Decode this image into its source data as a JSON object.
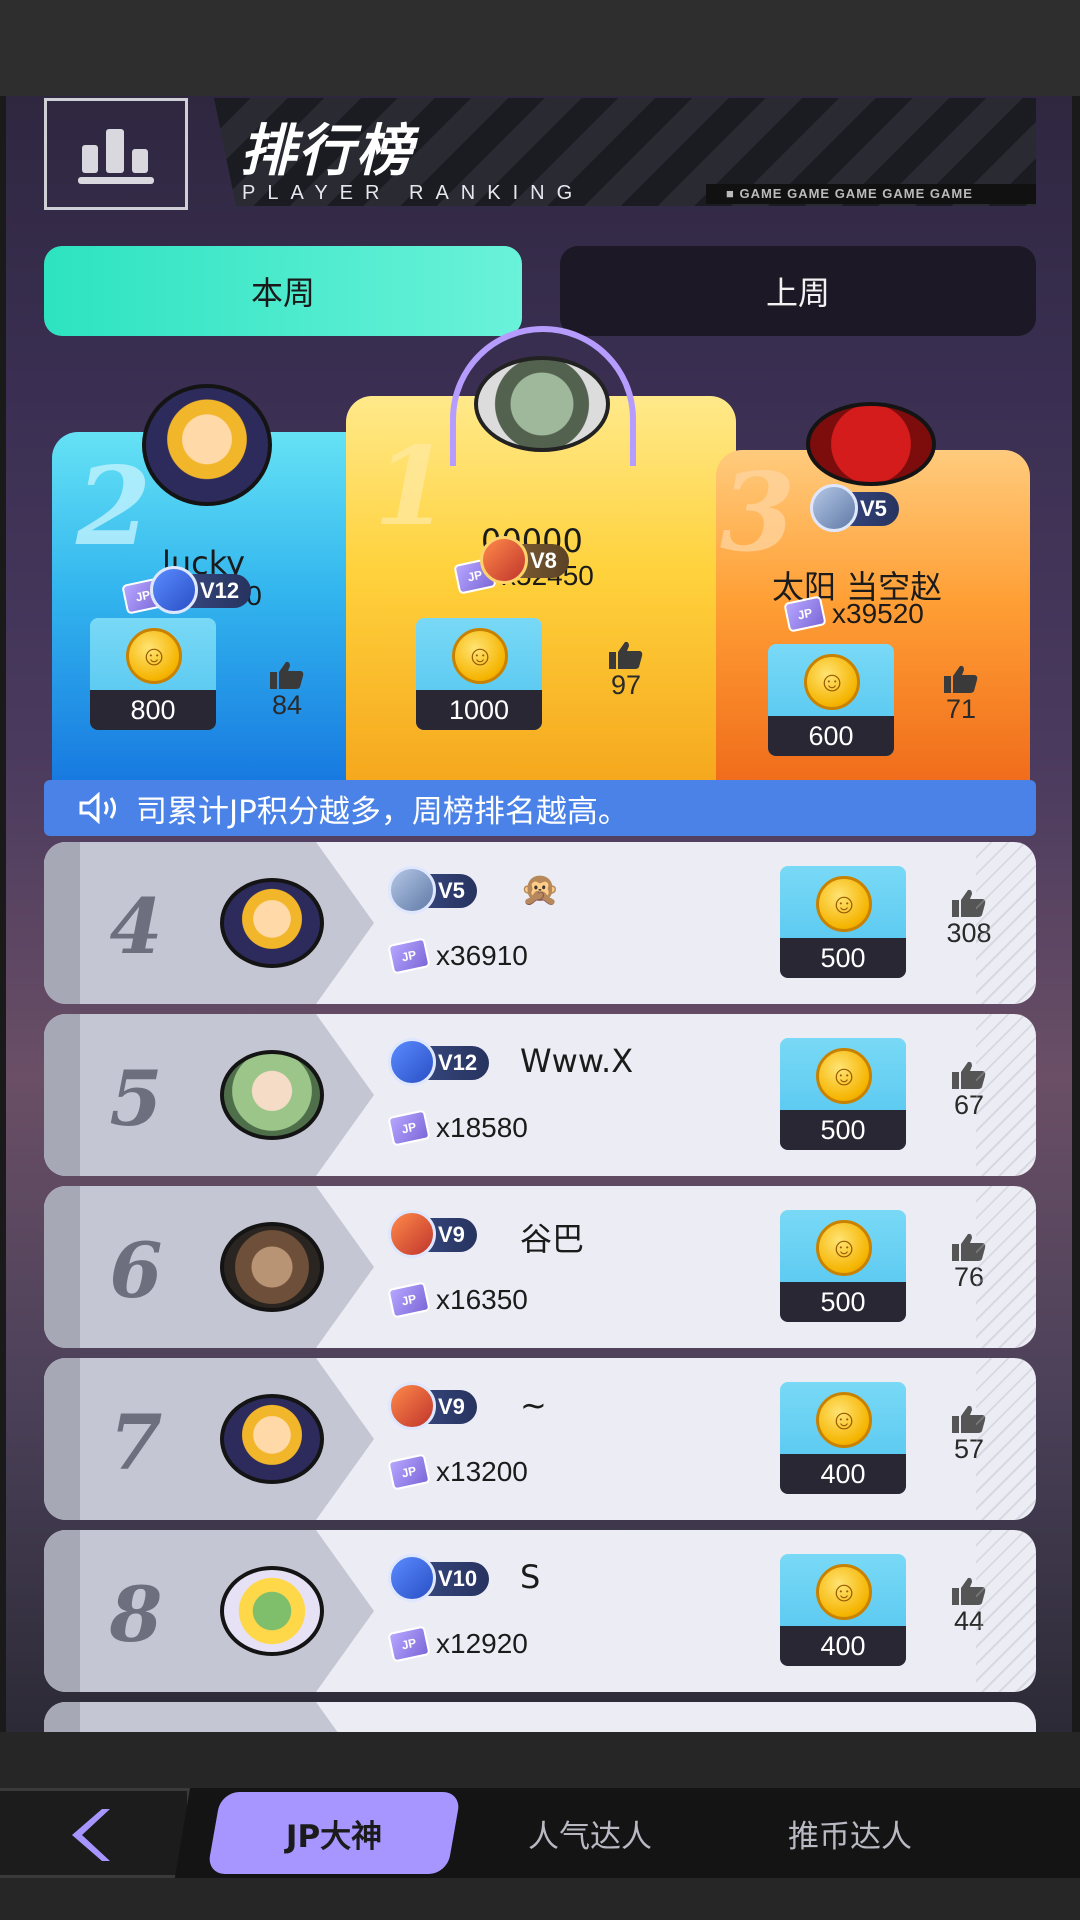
{
  "header": {
    "title": "排行榜",
    "subtitle": "PLAYER RANKING",
    "game_strip": "■ GAME  GAME  GAME  GAME  GAME"
  },
  "tabs": {
    "current": "本周",
    "previous": "上周"
  },
  "podium": {
    "first": {
      "rank": "1",
      "name": "00000",
      "vip": "V8",
      "jp": "x52450",
      "coins": "1000",
      "likes": "97"
    },
    "second": {
      "rank": "2",
      "name": "lucky",
      "vip": "V12",
      "jp": "x39650",
      "coins": "800",
      "likes": "84"
    },
    "third": {
      "rank": "3",
      "name": "太阳 当空赵",
      "vip": "V5",
      "jp": "x39520",
      "coins": "600",
      "likes": "71"
    }
  },
  "notice": "司累计JP积分越多，周榜排名越高。",
  "rows": [
    {
      "rank": "4",
      "vip": "V5",
      "name": "🙊",
      "jp": "x36910",
      "coins": "500",
      "likes": "308"
    },
    {
      "rank": "5",
      "vip": "V12",
      "name": "Www.X",
      "jp": "x18580",
      "coins": "500",
      "likes": "67"
    },
    {
      "rank": "6",
      "vip": "V9",
      "name": "谷巴",
      "jp": "x16350",
      "coins": "500",
      "likes": "76"
    },
    {
      "rank": "7",
      "vip": "V9",
      "name": "~",
      "jp": "x13200",
      "coins": "400",
      "likes": "57"
    },
    {
      "rank": "8",
      "vip": "V10",
      "name": "S",
      "jp": "x12920",
      "coins": "400",
      "likes": "44"
    }
  ],
  "jp_chip_label": "JP",
  "nav": {
    "active": "JP大神",
    "tab2": "人气达人",
    "tab3": "推币达人"
  },
  "colors": {
    "accent": "#a796ff",
    "tab_active": "#2de3c0",
    "notice": "#4a82e8"
  },
  "icons": [
    "bar-chart-icon",
    "speaker-icon",
    "thumbs-up-icon",
    "coin-icon",
    "jp-ticket-icon",
    "back-arrow-icon"
  ]
}
